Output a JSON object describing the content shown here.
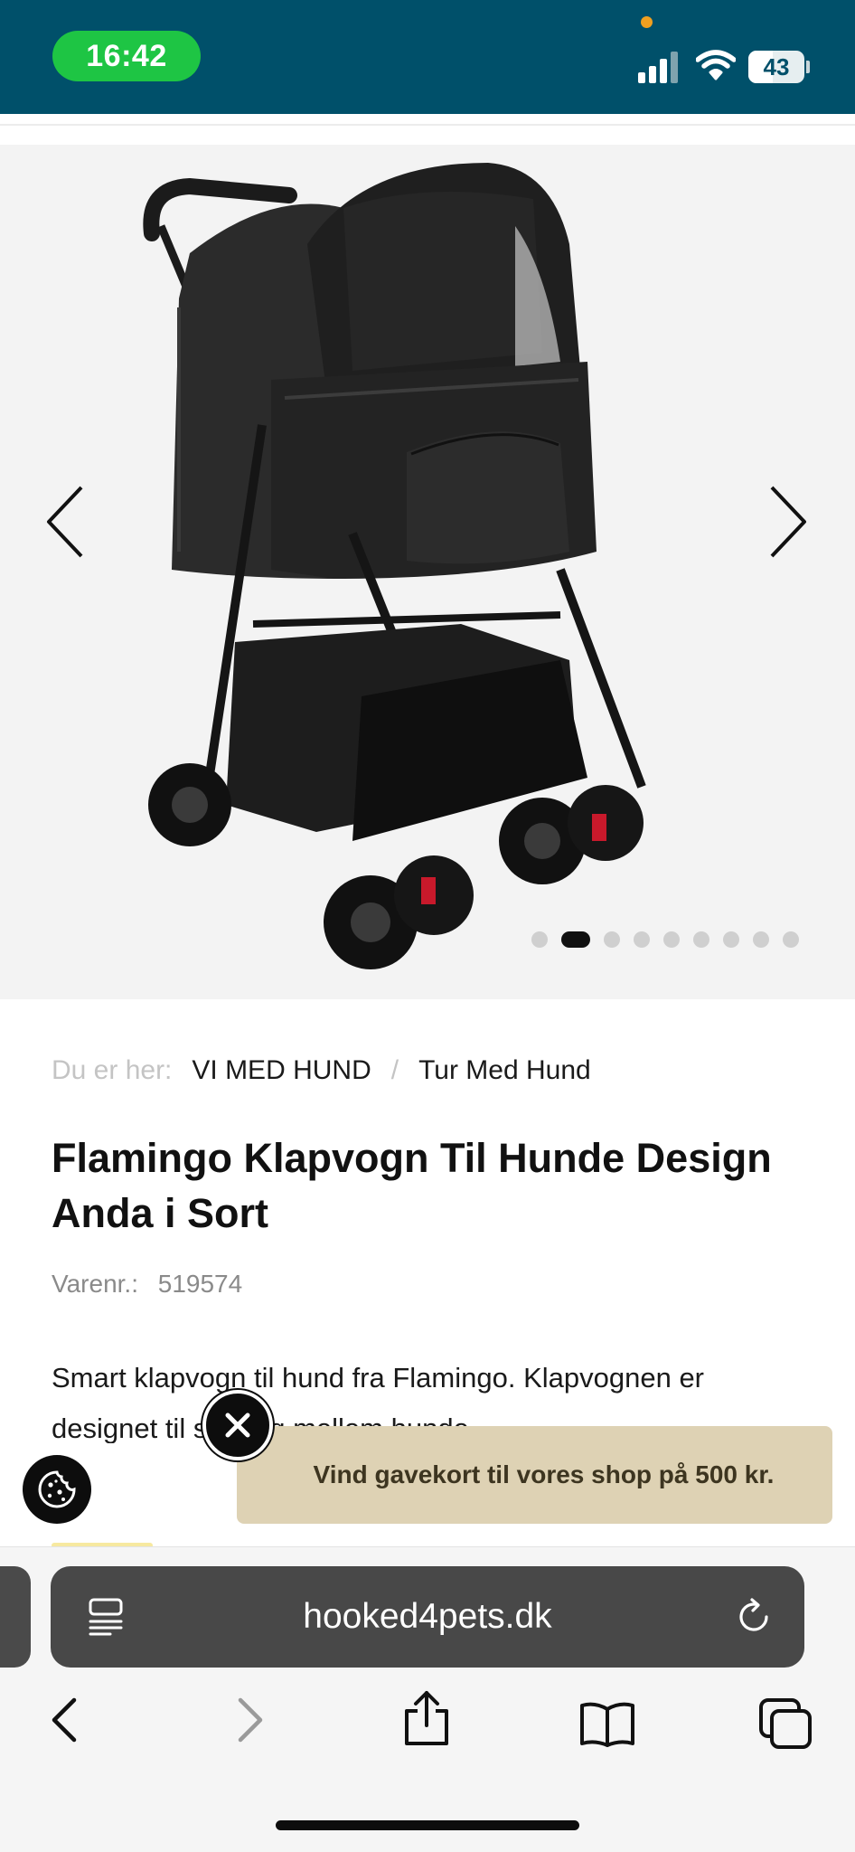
{
  "status_bar": {
    "time": "16:42",
    "battery_level": "43",
    "battery_fraction": 0.43,
    "signal_icon": "cellular-signal-icon",
    "wifi_icon": "wifi-icon"
  },
  "gallery": {
    "image_alt": "Flamingo Klapvogn Til Hunde Design Anda i Sort",
    "image_count": 9,
    "active_index": 1,
    "prev_icon": "chevron-left-icon",
    "next_icon": "chevron-right-icon"
  },
  "breadcrumb": {
    "prefix": "Du er her:",
    "items": [
      "VI MED HUND",
      "Tur Med Hund"
    ],
    "separator": "/"
  },
  "product": {
    "title": "Flamingo Klapvogn Til Hunde Design Anda i Sort",
    "sku_label": "Varenr.:",
    "sku": "519574",
    "description": "Smart klapvogn til hund fra Flamingo. Klapvognen er designet til små og mellem hunde."
  },
  "promo": {
    "text": "Vind gavekort til vores shop på 500 kr.",
    "close_icon": "close-icon"
  },
  "cookie": {
    "icon": "cookie-icon"
  },
  "browser": {
    "url": "hooked4pets.dk",
    "reader_icon": "reader-mode-icon",
    "reload_icon": "reload-icon",
    "toolbar": [
      "back-icon",
      "forward-icon",
      "share-icon",
      "bookmarks-icon",
      "tabs-icon"
    ]
  },
  "colors": {
    "status_bar": "#00506a",
    "time_pill": "#1ec544",
    "promo_bg": "#ded2b4",
    "gallery_bg": "#f3f3f3"
  }
}
